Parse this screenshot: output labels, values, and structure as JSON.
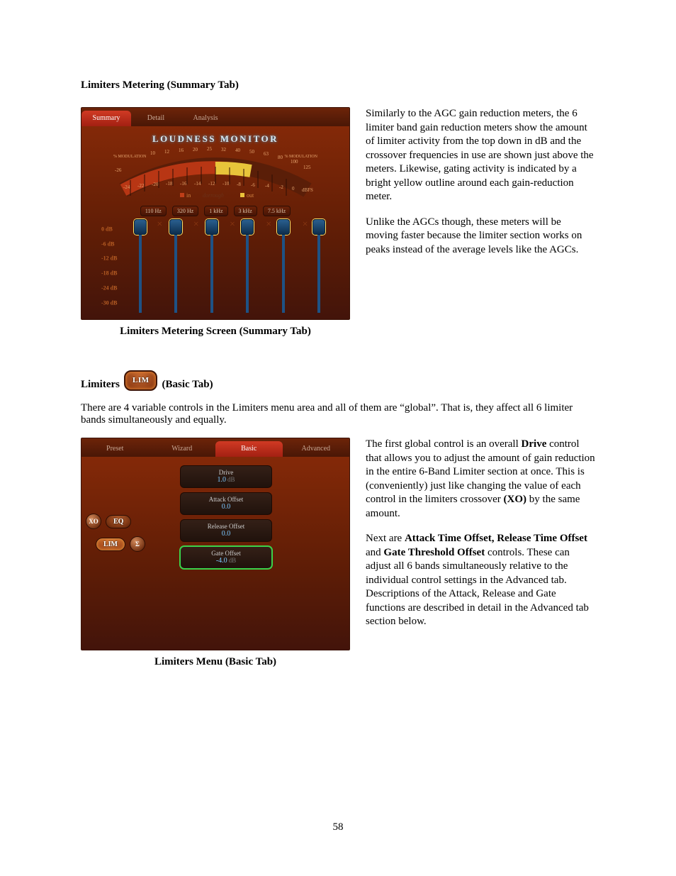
{
  "page_number": "58",
  "h_sec1": "Limiters Metering (Summary Tab)",
  "fig1_caption": "Limiters Metering Screen (Summary Tab)",
  "panel1": {
    "tabs": {
      "summary": "Summary",
      "detail": "Detail",
      "analysis": "Analysis"
    },
    "title": "LOUDNESS MONITOR",
    "mod_left": "% MODULATION",
    "mod_right": "% MODULATION",
    "scale_top": [
      "10",
      "12",
      "16",
      "20",
      "25",
      "32",
      "40",
      "50",
      "63",
      "80",
      "100",
      "125"
    ],
    "scale_bot": [
      "-26",
      "-24",
      "-22",
      "-20",
      "-18",
      "-16",
      "-14",
      "-12",
      "-10",
      "-8",
      "-6",
      "-4",
      "-2",
      "0",
      "dBFS"
    ],
    "legend_in": "in",
    "legend_out": "out",
    "legend_mid": "dorrough",
    "freq": [
      "110 Hz",
      "320 Hz",
      "1 kHz",
      "3 kHz",
      "7.5 kHz"
    ],
    "y_labels": [
      "0 dB",
      "-6 dB",
      "-12 dB",
      "-18 dB",
      "-24 dB",
      "-30 dB"
    ]
  },
  "para1a": "Similarly to the AGC gain reduction meters, the 6 limiter band gain reduction meters show the amount of limiter activity from the top down in dB and the crossover frequencies in use are shown just above the meters.  Likewise, gating activity is indicated by a bright yellow outline around each gain-reduction meter.",
  "para1b": "Unlike the AGCs though, these meters will be moving faster because the limiter section works on peaks instead of the average levels like the AGCs.",
  "inline_h_pre": "Limiters",
  "lim_btn": "LIM",
  "inline_h_post": "(Basic Tab)",
  "para2": "There are 4 variable controls in the Limiters menu area and all of them are “global”. That is, they affect all 6 limiter bands simultaneously and equally.",
  "panel2": {
    "tabs": {
      "preset": "Preset",
      "wizard": "Wizard",
      "basic": "Basic",
      "advanced": "Advanced"
    },
    "side": {
      "xo": "XO",
      "eq": "EQ",
      "lim": "LIM",
      "sigma": "Σ"
    },
    "ctl_drive_label": "Drive",
    "ctl_drive_val": "1.0",
    "ctl_drive_unit": "dB",
    "ctl_attack_label": "Attack Offset",
    "ctl_attack_val": "0.0",
    "ctl_release_label": "Release Offset",
    "ctl_release_val": "0.0",
    "ctl_gate_label": "Gate Offset",
    "ctl_gate_val": "-4.0",
    "ctl_gate_unit": "dB"
  },
  "fig2_caption": "Limiters Menu (Basic Tab)",
  "para3a_pre": "The first global control is an overall ",
  "para3a_b": "Drive",
  "para3a_mid": " control that allows you to adjust the amount of gain reduction in the entire 6-Band Limiter section at once.  This is (conveniently) just like changing the value of each control in the limiters crossover ",
  "para3a_b2": "(XO)",
  "para3a_post": " by the same amount.",
  "para3b_pre": "Next are ",
  "para3b_b1": "Attack Time Offset, Release Time Offset",
  "para3b_mid": " and ",
  "para3b_b2": "Gate Threshold Offset",
  "para3b_post": " controls. These can adjust all 6 bands simultaneously relative to the individual control settings in the Advanced tab. Descriptions of the Attack, Release and Gate functions are described in detail in the Advanced tab section below."
}
